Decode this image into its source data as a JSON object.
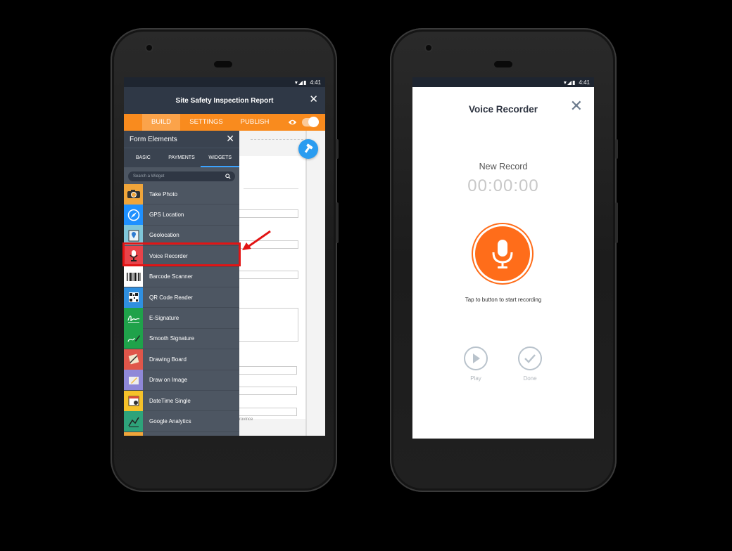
{
  "left_phone": {
    "status": {
      "time": "4:41"
    },
    "app_title": "Site Safety Inspection Report",
    "top_tabs": [
      {
        "label": "BUILD",
        "active": true
      },
      {
        "label": "SETTINGS",
        "active": false
      },
      {
        "label": "PUBLISH",
        "active": false
      }
    ],
    "panel": {
      "title": "Form Elements",
      "tabs": [
        {
          "label": "BASIC",
          "active": false
        },
        {
          "label": "PAYMENTS",
          "active": false
        },
        {
          "label": "WIDGETS",
          "active": true
        }
      ],
      "search_placeholder": "Search a Widget",
      "widgets": [
        {
          "label": "Take Photo",
          "icon": "camera-icon",
          "color": "#f0a53a"
        },
        {
          "label": "GPS Location",
          "icon": "compass-icon",
          "color": "#1e90ff"
        },
        {
          "label": "Geolocation",
          "icon": "map-pin-icon",
          "color": "#7fc6d9"
        },
        {
          "label": "Voice Recorder",
          "icon": "microphone-icon",
          "color": "#e8434a"
        },
        {
          "label": "Barcode Scanner",
          "icon": "barcode-icon",
          "color": "#ffffff"
        },
        {
          "label": "QR Code Reader",
          "icon": "qr-code-icon",
          "color": "#2f8fe0"
        },
        {
          "label": "E-Signature",
          "icon": "signature-icon",
          "color": "#1fa24a"
        },
        {
          "label": "Smooth Signature",
          "icon": "pen-signature-icon",
          "color": "#1fa24a"
        },
        {
          "label": "Drawing Board",
          "icon": "drawing-board-icon",
          "color": "#e0564a"
        },
        {
          "label": "Draw on Image",
          "icon": "draw-image-icon",
          "color": "#8f88d8"
        },
        {
          "label": "DateTime Single",
          "icon": "calendar-icon",
          "color": "#f5c12a"
        },
        {
          "label": "Google Analytics",
          "icon": "analytics-icon",
          "color": "#2ea37a"
        }
      ]
    },
    "form_fragment": "rovince",
    "highlight_color": "#e21414"
  },
  "right_phone": {
    "status": {
      "time": "4:41"
    },
    "title": "Voice Recorder",
    "record_title": "New Record",
    "timer": "00:00:00",
    "hint": "Tap to button to start recording",
    "play_label": "Play",
    "done_label": "Done",
    "accent_color": "#ff6d1a"
  }
}
